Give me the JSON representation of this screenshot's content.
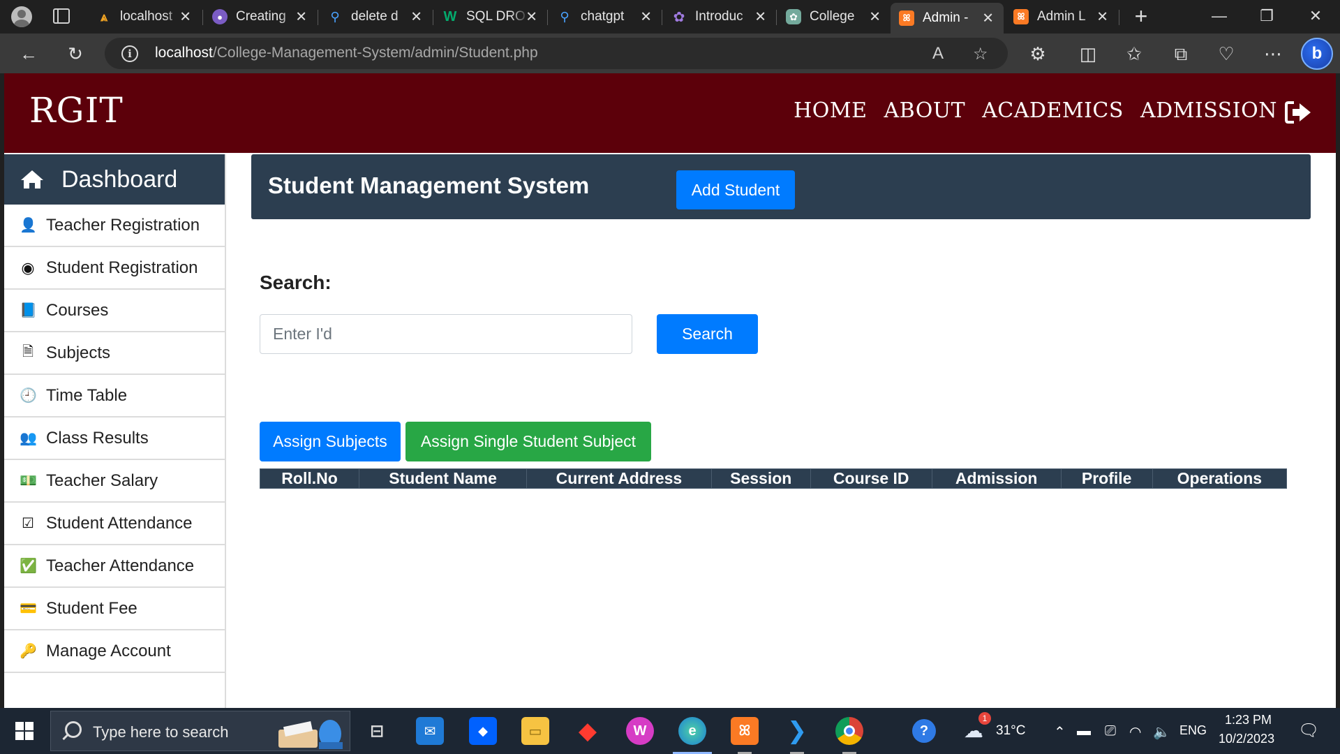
{
  "browser": {
    "tabs": [
      {
        "label": "localhost",
        "icon": "xampp-icon",
        "color": "#202020",
        "active": false
      },
      {
        "label": "Creating",
        "icon": "ai-chat-icon",
        "color": "#7b5cc4",
        "active": false
      },
      {
        "label": "delete d",
        "icon": "search-icon",
        "color": "#202020",
        "active": false
      },
      {
        "label": "SQL DRO",
        "icon": "w3schools-icon",
        "color": "#04aa6d",
        "active": false
      },
      {
        "label": "chatgpt",
        "icon": "search-icon",
        "color": "#202020",
        "active": false
      },
      {
        "label": "Introduc",
        "icon": "openai-icon",
        "color": "#6b4ca6",
        "active": false
      },
      {
        "label": "College",
        "icon": "chatgpt-icon",
        "color": "#74aa9c",
        "active": false
      },
      {
        "label": "Admin -",
        "icon": "xampp-icon",
        "color": "#fb7a24",
        "active": true
      },
      {
        "label": "Admin L",
        "icon": "xampp-icon",
        "color": "#fb7a24",
        "active": false
      }
    ],
    "url_host": "localhost",
    "url_path": "/College-Management-System/admin/Student.php"
  },
  "site": {
    "brand": "RGIT",
    "nav": [
      "HOME",
      "ABOUT",
      "ACADEMICS",
      "ADMISSION"
    ],
    "theme_color": "#5c000a"
  },
  "sidebar": {
    "dashboard": "Dashboard",
    "items": [
      {
        "label": "Teacher Registration",
        "icon": "user-icon"
      },
      {
        "label": "Student Registration",
        "icon": "user-circle-icon"
      },
      {
        "label": "Courses",
        "icon": "book-icon"
      },
      {
        "label": "Subjects",
        "icon": "document-icon"
      },
      {
        "label": "Time Table",
        "icon": "clock-icon"
      },
      {
        "label": "Class Results",
        "icon": "users-icon"
      },
      {
        "label": "Teacher Salary",
        "icon": "money-icon"
      },
      {
        "label": "Student Attendance",
        "icon": "check-square-outline-icon"
      },
      {
        "label": "Teacher Attendance",
        "icon": "check-square-icon"
      },
      {
        "label": "Student Fee",
        "icon": "credit-card-icon"
      },
      {
        "label": "Manage Account",
        "icon": "key-icon"
      }
    ]
  },
  "main": {
    "title": "Student Management System",
    "add_student": "Add Student",
    "search_label": "Search:",
    "search_placeholder": "Enter I'd",
    "search_button": "Search",
    "assign_subjects": "Assign Subjects",
    "assign_single": "Assign Single Student Subject",
    "table_headers": [
      "Roll.No",
      "Student Name",
      "Current Address",
      "Session",
      "Course ID",
      "Admission",
      "Profile",
      "Operations"
    ],
    "table_rows": []
  },
  "taskbar": {
    "search_placeholder": "Type here to search",
    "weather": "31°C",
    "weather_badge": "1",
    "language": "ENG",
    "time": "1:23 PM",
    "date": "10/2/2023"
  }
}
